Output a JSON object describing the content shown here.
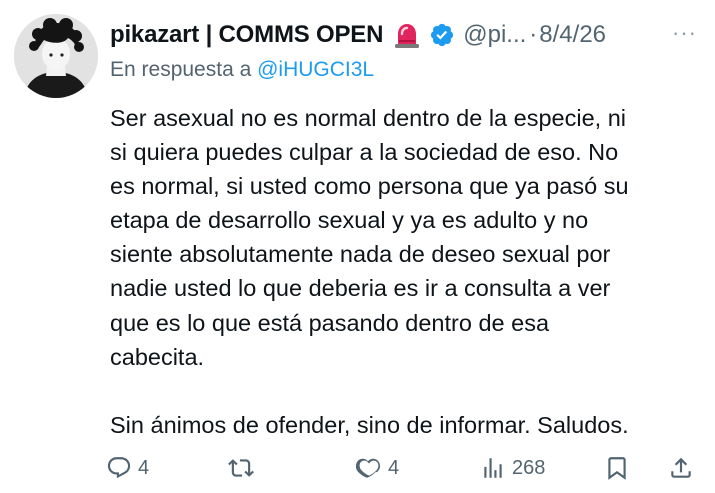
{
  "tweet": {
    "author": {
      "display_name": "pikazart | COMMS OPEN",
      "name_emoji": "police-siren-emoji",
      "verified_badge": "verified-badge-icon",
      "handle": "@pi...",
      "avatar": "avatar-illustration"
    },
    "separator": "·",
    "date": "8/4/26",
    "more_label": "···",
    "reply_to": {
      "prefix": "En respuesta a ",
      "mention": "@iHUGCI3L"
    },
    "text": {
      "lines": [
        "Ser asexual no es normal dentro de la especie, ni",
        "si quiera puedes culpar a la sociedad de eso. No",
        "es normal, si usted como persona que ya pasó su",
        "etapa de desarrollo sexual y ya es adulto y no",
        "siente absolutamente nada de deseo sexual por",
        "nadie usted lo que deberia es ir a consulta a ver",
        "que es lo que está pasando dentro de esa",
        "cabecita."
      ],
      "closing": "Sin ánimos de ofender, sino de informar. Saludos."
    },
    "actions": {
      "replies": {
        "icon": "reply-icon",
        "count": "4"
      },
      "retweets": {
        "icon": "retweet-icon",
        "count": ""
      },
      "likes": {
        "icon": "like-icon",
        "count": "4"
      },
      "views": {
        "icon": "views-icon",
        "count": "268"
      },
      "bookmark": {
        "icon": "bookmark-icon"
      },
      "share": {
        "icon": "share-icon"
      }
    }
  },
  "colors": {
    "text": "#0f1419",
    "secondary": "#536471",
    "accent": "#1d9bf0",
    "verified": "#1d9bf0",
    "siren": "#e0245e"
  }
}
